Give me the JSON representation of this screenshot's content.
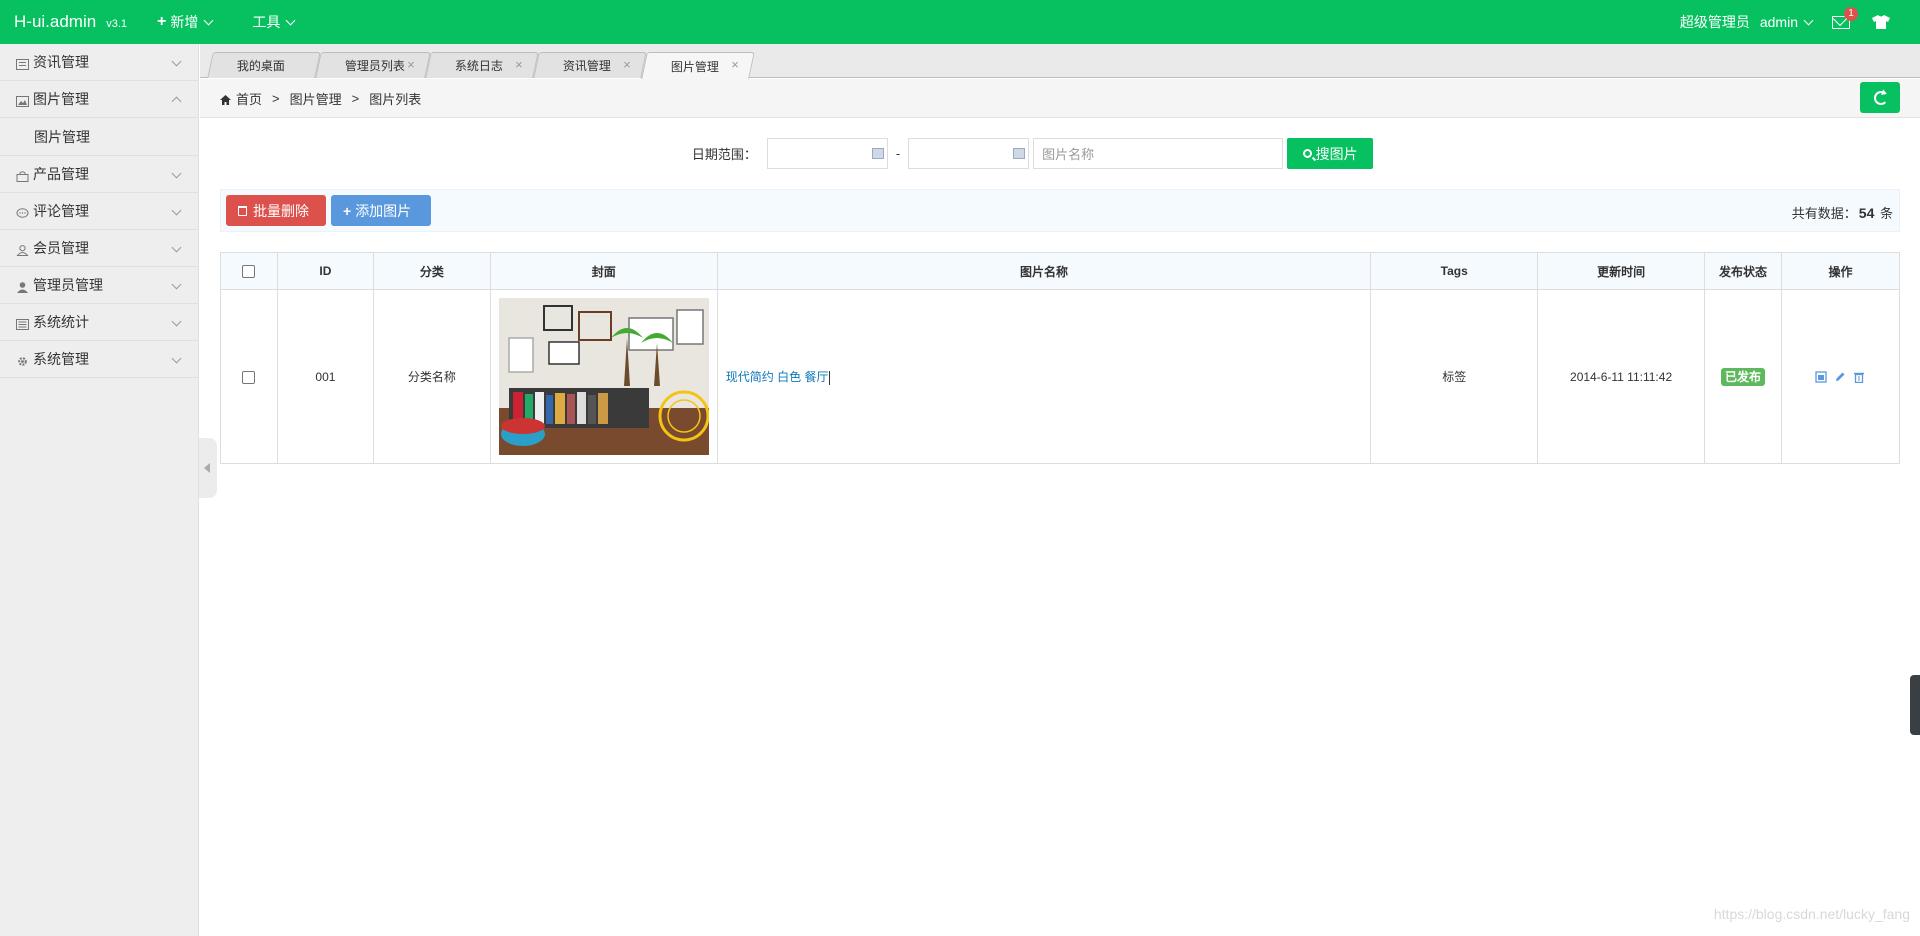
{
  "header": {
    "brand": "H-ui.admin",
    "version": "v3.1",
    "menu_add": "新增",
    "menu_tools": "工具",
    "user_role": "超级管理员",
    "user_name": "admin",
    "msg_count": "1"
  },
  "sidebar": {
    "items": [
      {
        "label": "资讯管理",
        "icon": "news-icon"
      },
      {
        "label": "图片管理",
        "icon": "picture-icon",
        "expanded": true
      },
      {
        "label": "产品管理",
        "icon": "bag-icon"
      },
      {
        "label": "评论管理",
        "icon": "comment-icon"
      },
      {
        "label": "会员管理",
        "icon": "member-icon"
      },
      {
        "label": "管理员管理",
        "icon": "admin-icon"
      },
      {
        "label": "系统统计",
        "icon": "stats-icon"
      },
      {
        "label": "系统管理",
        "icon": "gear-icon"
      }
    ],
    "sub_picture": "图片管理"
  },
  "tabs": [
    {
      "label": "我的桌面"
    },
    {
      "label": "管理员列表"
    },
    {
      "label": "系统日志"
    },
    {
      "label": "资讯管理"
    },
    {
      "label": "图片管理",
      "active": true
    }
  ],
  "tab_close": "×",
  "breadcrumb": {
    "home": "首页",
    "level1": "图片管理",
    "level2": "图片列表",
    "separator": ">"
  },
  "search": {
    "date_label": "日期范围：",
    "dash": "-",
    "name_placeholder": "图片名称",
    "button": "搜图片"
  },
  "toolbar": {
    "batch_delete": "批量删除",
    "add_picture": "添加图片",
    "total_prefix": "共有数据：",
    "total_count": "54",
    "total_suffix": "条"
  },
  "table": {
    "headers": {
      "id": "ID",
      "category": "分类",
      "cover": "封面",
      "name": "图片名称",
      "tags": "Tags",
      "updated": "更新时间",
      "status": "发布状态",
      "actions": "操作"
    },
    "rows": [
      {
        "id": "001",
        "category": "分类名称",
        "name": "现代简约 白色 餐厅",
        "tags": "标签",
        "updated": "2014-6-11 11:11:42",
        "status": "已发布"
      }
    ]
  },
  "watermark": "https://blog.csdn.net/lucky_fang"
}
